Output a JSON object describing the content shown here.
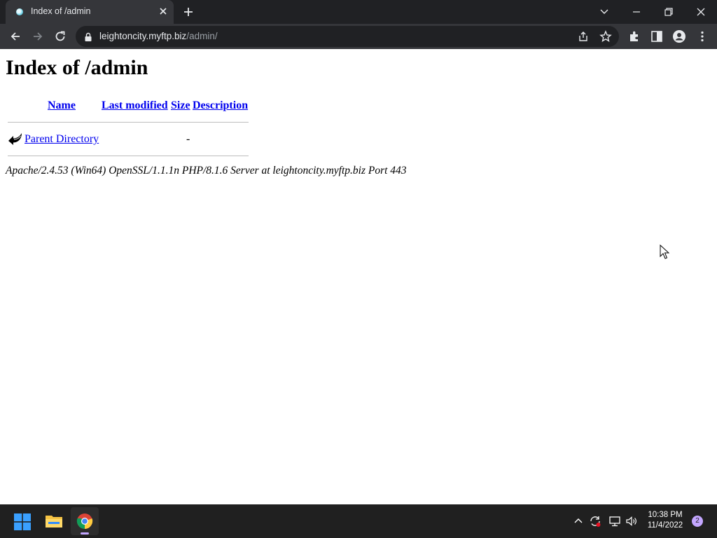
{
  "browser": {
    "tab": {
      "title": "Index of /admin"
    },
    "url": {
      "host": "leightoncity.myftp.biz",
      "path": "/admin/"
    }
  },
  "page": {
    "heading": "Index of /admin",
    "columns": [
      "Name",
      "Last modified",
      "Size",
      "Description"
    ],
    "rows": [
      {
        "name": "Parent Directory",
        "last_modified": "",
        "size": "-",
        "description": ""
      }
    ],
    "address": "Apache/2.4.53 (Win64) OpenSSL/1.1.1n PHP/8.1.6 Server at leightoncity.myftp.biz Port 443"
  },
  "taskbar": {
    "apps": [
      "windows-start",
      "file-explorer",
      "chrome"
    ],
    "clock": {
      "time": "10:38 PM",
      "date": "11/4/2022"
    },
    "notifications": "2"
  },
  "colors": {
    "link": "#0000ee",
    "chrome_dark": "#202124",
    "chrome_toolbar": "#35363a",
    "taskbar": "#202020",
    "accent": "#c3a6ff"
  }
}
